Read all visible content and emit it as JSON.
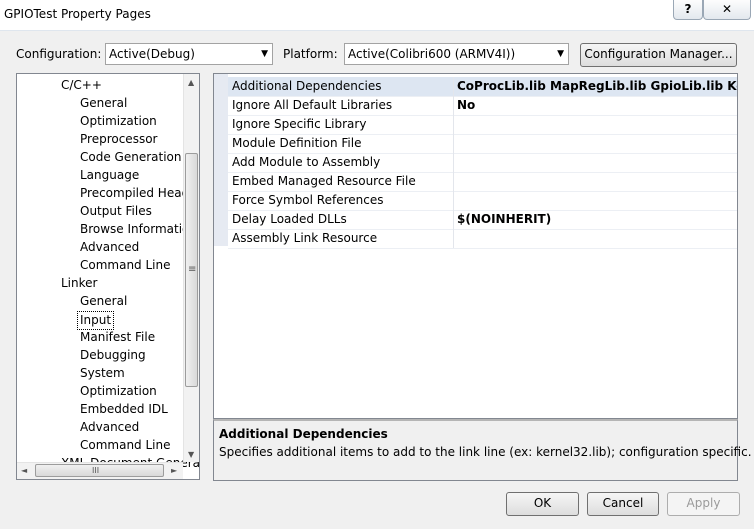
{
  "window": {
    "title": "GPIOTest Property Pages",
    "help_glyph": "?",
    "close_glyph": "✕"
  },
  "config": {
    "configuration_label": "Configuration:",
    "configuration_value": "Active(Debug)",
    "platform_label": "Platform:",
    "platform_value": "Active(Colibri600 (ARMV4I))",
    "manager_button": "Configuration Manager..."
  },
  "tree": {
    "items": [
      {
        "label": "C/C++",
        "level": 1
      },
      {
        "label": "General",
        "level": 2
      },
      {
        "label": "Optimization",
        "level": 2
      },
      {
        "label": "Preprocessor",
        "level": 2
      },
      {
        "label": "Code Generation",
        "level": 2
      },
      {
        "label": "Language",
        "level": 2
      },
      {
        "label": "Precompiled Heade",
        "level": 2
      },
      {
        "label": "Output Files",
        "level": 2
      },
      {
        "label": "Browse Information",
        "level": 2
      },
      {
        "label": "Advanced",
        "level": 2
      },
      {
        "label": "Command Line",
        "level": 2
      },
      {
        "label": "Linker",
        "level": 1
      },
      {
        "label": "General",
        "level": 2
      },
      {
        "label": "Input",
        "level": 2,
        "selected": true
      },
      {
        "label": "Manifest File",
        "level": 2
      },
      {
        "label": "Debugging",
        "level": 2
      },
      {
        "label": "System",
        "level": 2
      },
      {
        "label": "Optimization",
        "level": 2
      },
      {
        "label": "Embedded IDL",
        "level": 2
      },
      {
        "label": "Advanced",
        "level": 2
      },
      {
        "label": "Command Line",
        "level": 2
      },
      {
        "label": "XML Document Generator",
        "level": 1
      }
    ],
    "scroll_up_glyph": "▲",
    "scroll_down_glyph": "▼",
    "scroll_left_glyph": "◄",
    "scroll_right_glyph": "►",
    "grip_glyph": "≡",
    "hgrip_glyph": "III"
  },
  "properties": [
    {
      "name": "Additional Dependencies",
      "value": "CoProcLib.lib MapRegLib.lib GpioLib.lib KernelCallback",
      "selected": true
    },
    {
      "name": "Ignore All Default Libraries",
      "value": "No"
    },
    {
      "name": "Ignore Specific Library",
      "value": ""
    },
    {
      "name": "Module Definition File",
      "value": ""
    },
    {
      "name": "Add Module to Assembly",
      "value": ""
    },
    {
      "name": "Embed Managed Resource File",
      "value": ""
    },
    {
      "name": "Force Symbol References",
      "value": ""
    },
    {
      "name": "Delay Loaded DLLs",
      "value": "$(NOINHERIT)"
    },
    {
      "name": "Assembly Link Resource",
      "value": ""
    }
  ],
  "description": {
    "title": "Additional Dependencies",
    "text": "Specifies additional items to add to the link line (ex: kernel32.lib); configuration specific."
  },
  "buttons": {
    "ok": "OK",
    "cancel": "Cancel",
    "apply": "Apply"
  },
  "combo_arrow_glyph": "▼"
}
